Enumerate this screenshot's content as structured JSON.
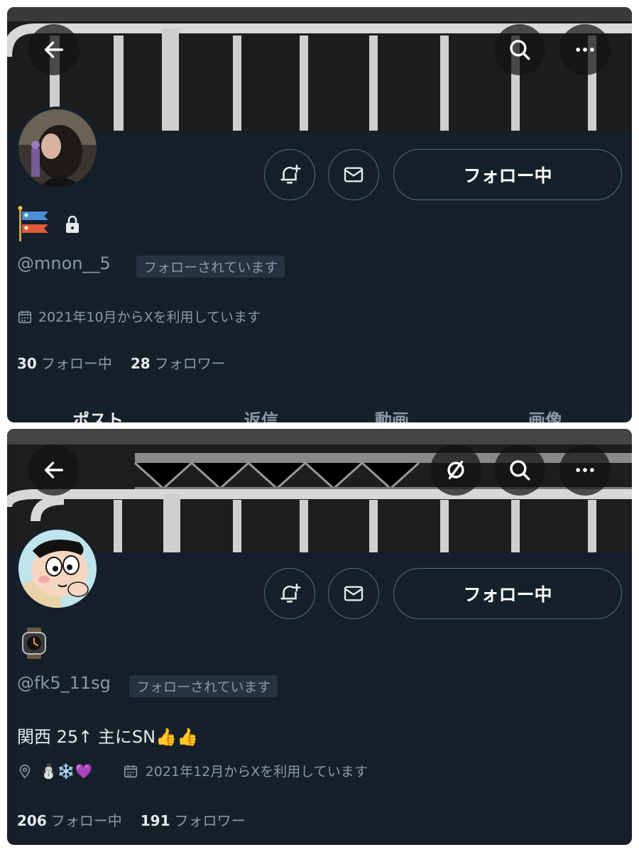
{
  "profile1": {
    "follow_label": "フォロー中",
    "handle": "@mnon__5",
    "follows_you": "フォローされています",
    "joined": "2021年10月からXを利用しています",
    "following_count": "30",
    "following_label": "フォロー中",
    "followers_count": "28",
    "followers_label": "フォロワー",
    "tabs": [
      "ポスト",
      "返信",
      "動画",
      "画像"
    ]
  },
  "profile2": {
    "follow_label": "フォロー中",
    "handle": "@fk5_11sg",
    "follows_you": "フォローされています",
    "bio": "関西 25↑ 主にSN👍👍",
    "location": "⛄❄️💜",
    "joined": "2021年12月からXを利用しています",
    "following_count": "206",
    "following_label": "フォロー中",
    "followers_count": "191",
    "followers_label": "フォロワー"
  },
  "colors": {
    "background": "#15202b",
    "text_primary": "#e7e9ea",
    "text_secondary": "#8b98a5",
    "badge_bg": "#273340",
    "border": "#5b6b7a"
  },
  "icons": [
    "back-arrow-icon",
    "search-icon",
    "more-icon",
    "notification-bell-icon",
    "mail-icon",
    "lock-icon",
    "calendar-icon",
    "location-pin-icon",
    "translate-slash-icon"
  ]
}
